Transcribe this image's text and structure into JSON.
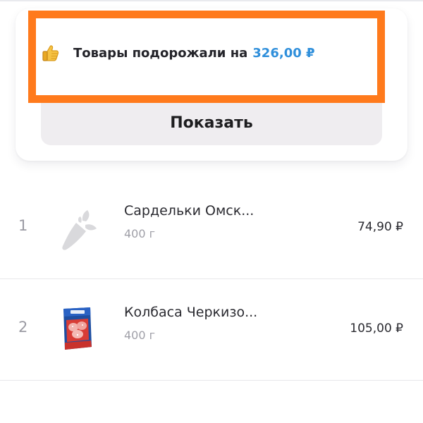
{
  "price_alert": {
    "icon": "thumbs-up-icon",
    "text": "Товары подорожали на",
    "amount": "326,00 ₽",
    "highlight_color": "#ff7a1c",
    "amount_color": "#2f8fdb"
  },
  "show_button": {
    "label": "Показать"
  },
  "products": [
    {
      "index": "1",
      "name": "Сардельки Омск...",
      "weight": "400 г",
      "price": "74,90 ₽",
      "image": "carrot-placeholder-icon"
    },
    {
      "index": "2",
      "name": "Колбаса Черкизо...",
      "weight": "400 г",
      "price": "105,00 ₽",
      "image": "sausage-package-image"
    }
  ]
}
